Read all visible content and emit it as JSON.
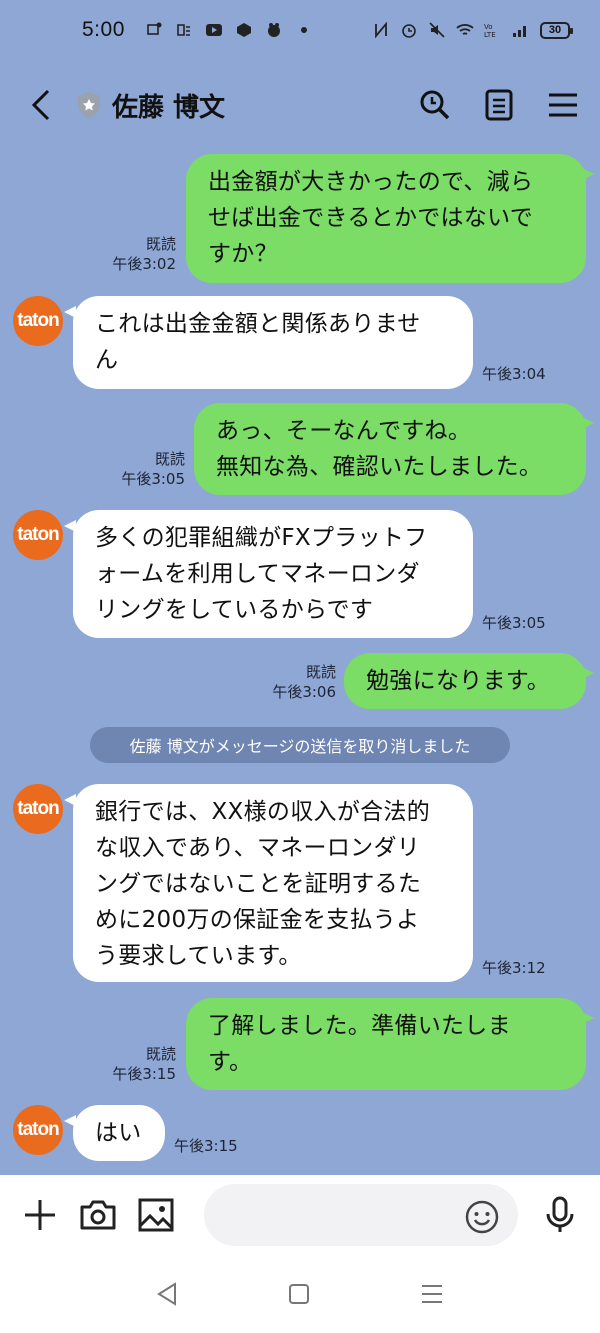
{
  "status_bar": {
    "time": "5:00",
    "battery": "30"
  },
  "header": {
    "title": "佐藤 博文"
  },
  "avatar_text": "taton",
  "messages": [
    {
      "side": "out",
      "text": "出金額が大きかったので、減らせば出金できるとかではないですか？",
      "lines": [
        "出金額が大きかったので、減ら",
        "せば出金できるとかではないで",
        "すか？"
      ],
      "read": "既読",
      "time": "午後3:02"
    },
    {
      "side": "in",
      "lines": [
        "これは出金金額と関係ありませ",
        "ん"
      ],
      "time": "午後3:04"
    },
    {
      "side": "out",
      "lines": [
        "あっ、そーなんですね。",
        "無知な為、確認いたしました。"
      ],
      "read": "既読",
      "time": "午後3:05"
    },
    {
      "side": "in",
      "lines": [
        "多くの犯罪組織がFXプラットフ",
        "ォームを利用してマネーロンダ",
        "リングをしているからです"
      ],
      "time": "午後3:05"
    },
    {
      "side": "out",
      "lines": [
        "勉強になります。"
      ],
      "read": "既読",
      "time": "午後3:06"
    },
    {
      "side": "in",
      "lines": [
        "銀行では、XX様の収入が合法的",
        "な収入であり、マネーロンダリ",
        "ングではないことを証明するた",
        "めに200万の保証金を支払うよ",
        "う要求しています。"
      ],
      "time": "午後3:12"
    },
    {
      "side": "out",
      "lines": [
        "了解しました。準備いたしま",
        "す。"
      ],
      "read": "既読",
      "time": "午後3:15"
    },
    {
      "side": "in",
      "lines": [
        "はい"
      ],
      "time": "午後3:15"
    }
  ],
  "system_message": "佐藤 博文がメッセージの送信を取り消しました",
  "input": {
    "placeholder": ""
  },
  "colors": {
    "background": "#8ea7d4",
    "outgoing_bubble": "#7bdc66",
    "incoming_bubble": "#ffffff",
    "avatar": "#ea6a1e"
  }
}
